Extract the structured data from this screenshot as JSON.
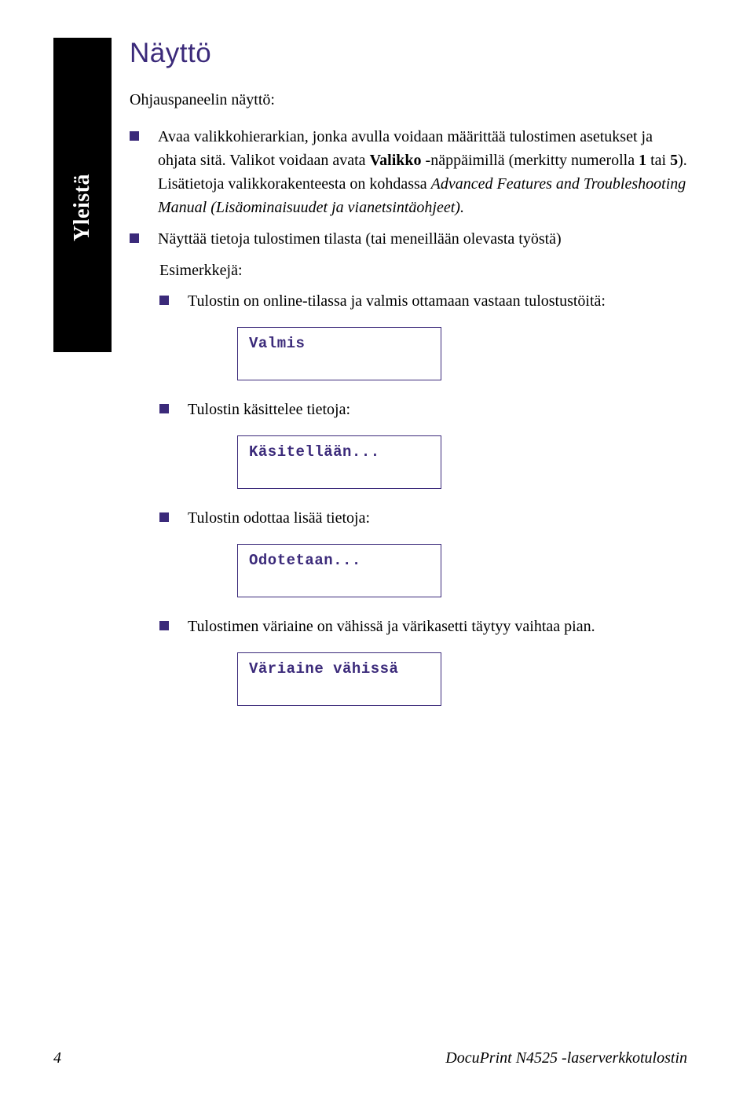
{
  "sidebar_label": "Yleistä",
  "section_title": "Näyttö",
  "intro": "Ohjauspaneelin näyttö:",
  "bullet1": {
    "part1": "Avaa valikkohierarkian, jonka avulla voidaan määrittää tulostimen asetukset ja ohjata sitä. Valikot voidaan avata ",
    "bold1": "Valikko",
    "part2": " -näppäimillä (merkitty numerolla ",
    "bold2": "1",
    "part3": " tai ",
    "bold3": "5",
    "part4": "). Lisätietoja valikkorakenteesta on kohdassa ",
    "italic1": "Advanced Features and Troubleshooting Manual (Lisäominaisuudet ja vianetsintäohjeet).",
    "part5": ""
  },
  "bullet2": "Näyttää tietoja tulostimen tilasta (tai meneillään olevasta työstä)",
  "esimerkkeja": "Esimerkkejä:",
  "subbullet1": "Tulostin on online-tilassa ja valmis ottamaan vastaan tulostustöitä:",
  "lcd1": "Valmis",
  "subbullet2": "Tulostin käsittelee tietoja:",
  "lcd2": "Käsitellään...",
  "subbullet3": "Tulostin odottaa lisää tietoja:",
  "lcd3": "Odotetaan...",
  "subbullet4": "Tulostimen väriaine on vähissä ja värikasetti täytyy vaihtaa pian.",
  "lcd4": "Väriaine vähissä",
  "footer": {
    "page": "4",
    "title": "DocuPrint N4525 -laserverkkotulostin"
  }
}
